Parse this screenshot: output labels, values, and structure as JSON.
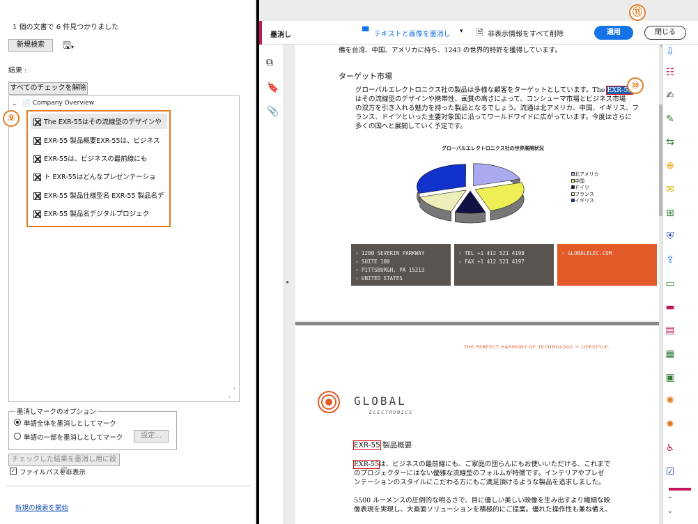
{
  "left": {
    "summary": "1 個の文書で 6 件見つかりました",
    "new_search": "新規検索",
    "results_label": "結果 :",
    "uncheck_all": "すべてのチェックを解除",
    "doc_name": "Company Overview",
    "results": [
      "The EXR-55はその流線型のデザインや",
      "EXR-55 製品概要EXR-55は、ビジネス",
      "EXR-55は、ビジネスの最前線にも",
      "ト EXR-55はどんなプレゼンテーショ",
      "EXR-55 製品仕様型名 EXR-55 製品名デ",
      "EXR-55 製品名デジタルプロジェク"
    ],
    "options_title": "墨消しマークのオプション",
    "opt_whole": "単語全体を墨消しとしてマーク",
    "opt_part": "単語の一部を墨消しとしてマーク",
    "settings": "設定...",
    "apply_checked": "チェックした結果を墨消し用に設定",
    "hide_path": "ファイルパスを非表示",
    "start_new": "新規の検索を開始"
  },
  "toolbar": {
    "title": "墨消し",
    "redact_text_image": "テキストと画像を墨消し",
    "remove_hidden": "非表示情報をすべて削除",
    "apply": "適用",
    "close": "閉じる"
  },
  "badges": {
    "b9": "⑨",
    "b10": "⑩",
    "b11": "⑪"
  },
  "doc": {
    "top_line": "備を台湾、中国、アメリカに持ち、1243 の世界的特許を獲得しています。",
    "section": "ターゲット市場",
    "para_pre": "グローバルエレクトロニクス社の製品は多様な顧客をターゲットとしています。The ",
    "para_hl": "EXR-55",
    "para_lines": [
      "はその流線型のデザインや携帯性、画質の高さによって、コンシューマ市場とビジネス市場",
      "の双方を引き入れる魅力を持った製品となるでしょう。流通は北アメリカ、中国、イギリス、フ",
      "ランス、ドイツといった主要対象国に沿ってワールドワイドに広がっています。今度はさらに",
      "多くの国へと展開していく予定です。"
    ],
    "addr1": "› 1200 SEVERIN PARKWAY\n› SUITE 100\n› PITTSBURGH, PA 15213\n› UNITED STATES",
    "addr2": "› TEL +1 412 521 4198\n› FAX +1 412 521 4197",
    "addr3": "› GLOBALELEC.COM",
    "tagline": "THE PERFECT HARMONY OF TECHNOLOGY + LIFESTYLE.",
    "logo1": "GLOBAL",
    "logo2": "ELECTRONICS",
    "overview_hl": "EXR-55",
    "overview_rest": " 製品概要",
    "body_hl": "EXR-55",
    "body1": "は、ビジネスの最前線にも、ご家庭の団らんにもお使いいただける、これまで",
    "body2": "のプロジェクターにはない優雅な流線型のフォルムが特徴です。インテリアやプレゼ",
    "body3": "ンテーションのスタイルにこだわる方にもご満足頂けるような製品を追求しました。",
    "body4": "5500 ルーメンスの圧倒的な明るさで、目に優しい美しい映像を生み出すより繊細な映",
    "body5": "像表現を実現し、大画面ソリューションを積極的にご提案。優れた操作性も兼ね備え、"
  },
  "chart_data": {
    "type": "pie",
    "title": "グローバルエレクトロニクス社の世界展開状況",
    "legend": [
      "北アメリカ",
      "中国",
      "ドイツ",
      "フランス",
      "イギリス"
    ],
    "colors": [
      "#aaaaee",
      "#eeee55",
      "#111144",
      "#eeeebb",
      "#1133cc"
    ],
    "values": [
      20,
      25,
      10,
      15,
      30
    ],
    "legend_position": "right"
  },
  "colors": {
    "accent": "#1473e6",
    "badge": "#e07c22",
    "redact": "#d11"
  }
}
